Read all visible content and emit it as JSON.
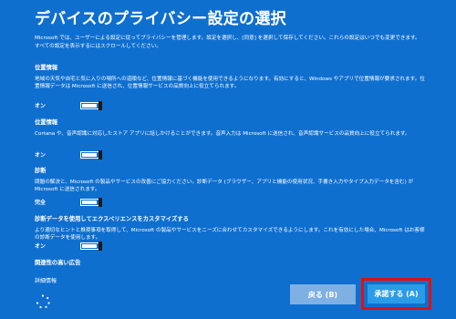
{
  "page": {
    "title": "デバイスのプライバシー設定の選択",
    "intro": "Microsoft では、ユーザーによる設定に従ってプライバシーを管理します。設定を選択し、[同意] を選択して保存してください。これらの設定はいつでも変更できます。すべての設定を表示するにはスクロールしてください。"
  },
  "sections": [
    {
      "title": "位置情報",
      "desc": "地域の天気や自宅と気に入りの場所への道順など、位置情報に基づく機能を使用できるようになります。有効にすると、Windows やアプリで位置情報が要求されます。位置情報データは Microsoft に送信され、位置情報サービスの品質向上に役立てられます。",
      "state": "オン",
      "toggle_on": true
    },
    {
      "title": "位置情報",
      "desc": "Cortana や、音声認識に対応したストア アプリに話しかけることができます。音声入力は Microsoft に送信され、音声認識サービスの品質向上に役立てられます。",
      "state": "オン",
      "toggle_on": true
    },
    {
      "title": "診断",
      "desc": "問題の解決と、Microsoft の製品やサービスの改善にご協力ください。診断データ (ブラウザー、アプリと機能の使用状況、手書き入力やタイプ入力データを含む) が Microsoft に送信されます。",
      "state": "完全",
      "toggle_on": true
    },
    {
      "title": "診断データを使用してエクスペリエンスをカスタマイズする",
      "desc": "より適切なヒントと推奨事項を取得して、Microsoft の製品やサービスをニーズに合わせてカスタマイズできるようにします。これを有効にした場合、Microsoft はお客様の診断データを使用します。",
      "state": "オン",
      "toggle_on": true
    },
    {
      "title": "関連性の高い広告",
      "desc": "",
      "state": "",
      "toggle_on": false
    }
  ],
  "footer": {
    "details_label": "詳細情報",
    "back_label": "戻る (B)",
    "accept_label": "承諾する (A)"
  },
  "colors": {
    "background": "#0f6fcf",
    "back_button": "#7fb0e3",
    "accept_button": "#2a9be8",
    "highlight_border": "#e01010"
  },
  "icons": {
    "busy": "loading-spinner-icon"
  }
}
